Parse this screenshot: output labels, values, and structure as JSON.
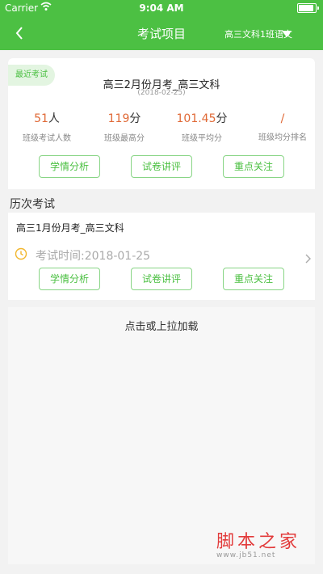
{
  "status_bar": {
    "carrier": "Carrier",
    "time": "9:04 AM",
    "battery_level": 0.9
  },
  "nav": {
    "title": "考试项目",
    "class_select": "高三文科1班语文"
  },
  "recent_exam": {
    "badge": "最近考试",
    "title": "高三2月份月考_高三文科",
    "date": "(2018-02-25)",
    "stats": [
      {
        "value": "51",
        "unit": "人",
        "label": "班级考试人数"
      },
      {
        "value": "119",
        "unit": "分",
        "label": "班级最高分"
      },
      {
        "value": "101.45",
        "unit": "分",
        "label": "班级平均分"
      },
      {
        "value": "/",
        "unit": "",
        "label": "班级均分排名"
      }
    ],
    "buttons": [
      "学情分析",
      "试卷讲评",
      "重点关注"
    ]
  },
  "history": {
    "section_title": "历次考试",
    "items": [
      {
        "title": "高三1月份月考_高三文科",
        "time": "考试时间:2018-01-25",
        "buttons": [
          "学情分析",
          "试卷讲评",
          "重点关注"
        ]
      }
    ]
  },
  "load_more": "点击或上拉加载",
  "watermark": {
    "text": "脚本之家",
    "url": "www.jb51.net"
  },
  "colors": {
    "primary": "#4cc043",
    "accent": "#e06936",
    "watermark": "#e23b3b"
  }
}
